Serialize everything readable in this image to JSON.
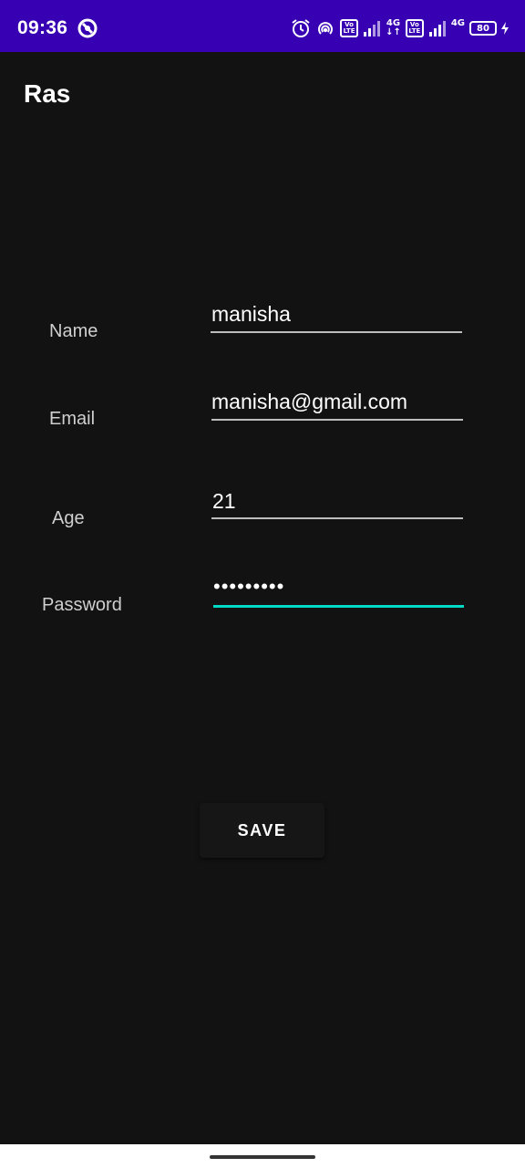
{
  "status_bar": {
    "time": "09:36",
    "battery_level": "80",
    "network_label_1": "4G",
    "network_label_2": "4G",
    "volte_top": "Vo",
    "volte_bottom": "LTE",
    "icons": [
      "do-not-disturb-icon",
      "alarm-icon",
      "hotspot-icon",
      "volte-icon",
      "signal-icon",
      "battery-icon",
      "charging-icon"
    ]
  },
  "app_bar": {
    "title": "Ras"
  },
  "form": {
    "name_label": "Name",
    "name_value": "manisha",
    "email_label": "Email",
    "email_value": "manisha@gmail.com",
    "age_label": "Age",
    "age_value": "21",
    "password_label": "Password",
    "password_value": "•••••••••"
  },
  "actions": {
    "save_label": "SAVE"
  },
  "colors": {
    "status_bar": "#3700b3",
    "background": "#121212",
    "focus_accent": "#03dac5"
  }
}
